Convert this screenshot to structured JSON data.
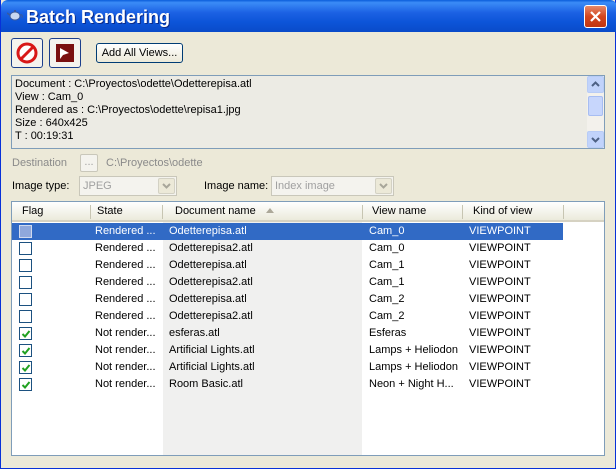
{
  "window": {
    "title": "Batch Rendering",
    "icon": "teapot-icon",
    "close_icon": "close-icon"
  },
  "toolbar": {
    "stop_icon": "stop-icon",
    "render_icon": "render-icon",
    "add_all_label": "Add All Views..."
  },
  "info": {
    "lines": [
      "Document : C:\\Proyectos\\odette\\Odetterepisa.atl",
      "View : Cam_0",
      "Rendered as : C:\\Proyectos\\odette\\repisa1.jpg",
      "Size : 640x425",
      "T : 00:19:31"
    ]
  },
  "destination": {
    "label": "Destination",
    "browse_label": "...",
    "path": "C:\\Proyectos\\odette"
  },
  "image_type": {
    "label": "Image type:",
    "value": "JPEG"
  },
  "image_name": {
    "label": "Image name:",
    "value": "Index image"
  },
  "grid": {
    "columns": [
      "Flag",
      "State",
      "Document name",
      "View name",
      "Kind of view"
    ],
    "sort_icon": "sort-ascending-icon",
    "rows": [
      {
        "checked": false,
        "selected": true,
        "state": "Rendered ...",
        "document": "Odetterepisa.atl",
        "view": "Cam_0",
        "kind": "VIEWPOINT"
      },
      {
        "checked": false,
        "selected": false,
        "state": "Rendered ...",
        "document": "Odetterepisa2.atl",
        "view": "Cam_0",
        "kind": "VIEWPOINT"
      },
      {
        "checked": false,
        "selected": false,
        "state": "Rendered ...",
        "document": "Odetterepisa.atl",
        "view": "Cam_1",
        "kind": "VIEWPOINT"
      },
      {
        "checked": false,
        "selected": false,
        "state": "Rendered ...",
        "document": "Odetterepisa2.atl",
        "view": "Cam_1",
        "kind": "VIEWPOINT"
      },
      {
        "checked": false,
        "selected": false,
        "state": "Rendered ...",
        "document": "Odetterepisa.atl",
        "view": "Cam_2",
        "kind": "VIEWPOINT"
      },
      {
        "checked": false,
        "selected": false,
        "state": "Rendered ...",
        "document": "Odetterepisa2.atl",
        "view": "Cam_2",
        "kind": "VIEWPOINT"
      },
      {
        "checked": true,
        "selected": false,
        "state": "Not render...",
        "document": "esferas.atl",
        "view": "Esferas",
        "kind": "VIEWPOINT"
      },
      {
        "checked": true,
        "selected": false,
        "state": "Not render...",
        "document": "Artificial Lights.atl",
        "view": "Lamps + Heliodon",
        "kind": "VIEWPOINT"
      },
      {
        "checked": true,
        "selected": false,
        "state": "Not render...",
        "document": "Artificial Lights.atl",
        "view": "Lamps + Heliodon",
        "kind": "VIEWPOINT"
      },
      {
        "checked": true,
        "selected": false,
        "state": "Not render...",
        "document": "Room Basic.atl",
        "view": "Neon + Night H...",
        "kind": "VIEWPOINT"
      }
    ]
  },
  "colors": {
    "title_bar": "#0c54d8",
    "selection": "#316ac5",
    "check": "#21a121"
  }
}
